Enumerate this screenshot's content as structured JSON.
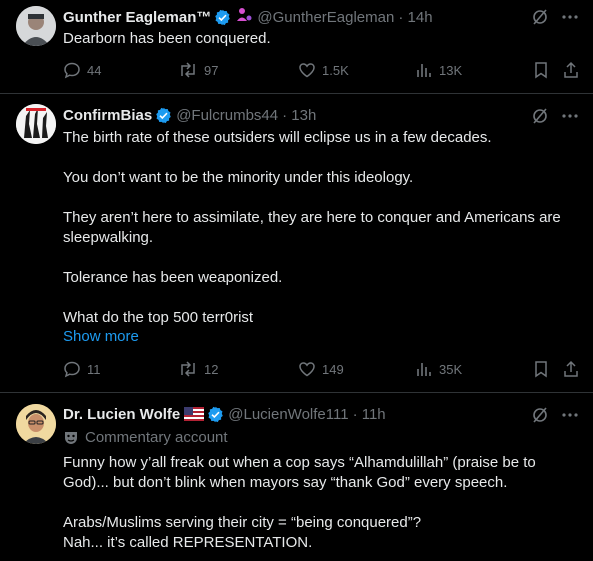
{
  "tweets": [
    {
      "name": "Gunther Eagleman™",
      "handle": "@GuntherEagleman",
      "time": "· 14h",
      "text": "Dearborn has been conquered.",
      "replies": "44",
      "reposts": "97",
      "likes": "1.5K",
      "views": "13K"
    },
    {
      "name": "ConfirmBias",
      "handle": "@Fulcrumbs44",
      "time": "· 13h",
      "text": "The birth rate of these outsiders will eclipse us in a few decades.\n\nYou don’t want to be the minority under this ideology.\n\nThey aren’t here to assimilate, they are here to conquer and Americans are sleepwalking.\n\nTolerance has been weaponized.\n\nWhat do the top 500 terr0rist",
      "show_more": "Show more",
      "replies": "11",
      "reposts": "12",
      "likes": "149",
      "views": "35K"
    },
    {
      "name": "Dr. Lucien Wolfe",
      "handle": "@LucienWolfe111",
      "time": "· 11h",
      "label": "Commentary account",
      "text": "Funny how y’all freak out when a cop says “Alhamdulillah” (praise be to God)... but don’t blink when mayors say “thank God” every speech.\n\nArabs/Muslims serving their city = “being conquered”?\nNah... it’s called REPRESENTATION."
    }
  ],
  "icons": {
    "verified": "verified-badge-icon",
    "grok": "grok-icon",
    "more": "more-dots-icon",
    "reply": "reply-icon",
    "repost": "repost-icon",
    "like": "like-icon",
    "views": "views-icon",
    "bookmark": "bookmark-icon",
    "share": "share-icon"
  },
  "colors": {
    "background": "#000000",
    "text": "#e7e9ea",
    "muted": "#71767b",
    "accent": "#1d9bf0",
    "divider": "#2f3336"
  }
}
